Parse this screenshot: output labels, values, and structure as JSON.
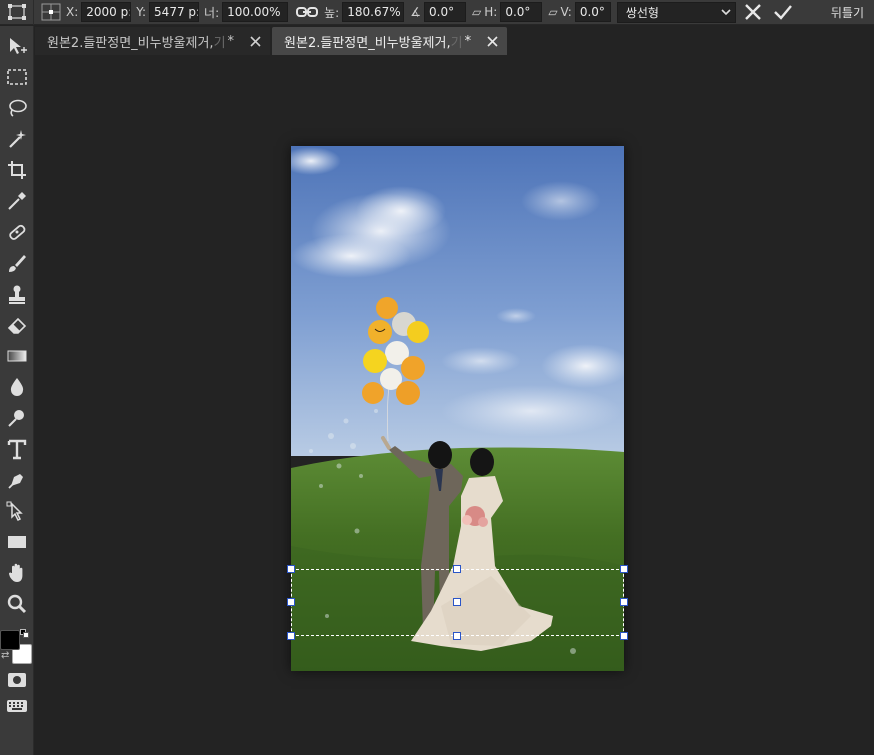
{
  "options_bar": {
    "x_label": "X:",
    "x_value": "2000 p:",
    "y_label": "Y:",
    "y_value": "5477 p:",
    "width_label": "너:",
    "width_value": "100.00%",
    "height_label": "높:",
    "height_value": "180.67%",
    "angle_value": "0.0°",
    "skew_h_label": "H:",
    "skew_h_value": "0.0°",
    "skew_v_label": "V:",
    "skew_v_value": "0.0°",
    "interpolation": "쌍선형",
    "warp_label": "뒤틀기"
  },
  "tabs": [
    {
      "name": "원본2.들판정면_비누방울제거,",
      "fade": "기",
      "star": "*",
      "active": false
    },
    {
      "name": "원본2.들판정면_비누방울제거,",
      "fade": "기",
      "star": "*",
      "active": true
    }
  ],
  "toolbox": {
    "tools": [
      "move-tool",
      "marquee-tool",
      "lasso-tool",
      "magic-wand-tool",
      "crop-tool",
      "eyedropper-tool",
      "healing-tool",
      "brush-tool",
      "stamp-tool",
      "eraser-tool",
      "gradient-tool",
      "blur-tool",
      "dodge-tool",
      "type-tool",
      "pen-tool",
      "path-select-tool",
      "rectangle-tool",
      "hand-tool",
      "zoom-tool"
    ],
    "foreground_color": "#000000",
    "background_color": "#ffffff"
  },
  "colors": {
    "selection_handle_border": "#2a55c8"
  }
}
